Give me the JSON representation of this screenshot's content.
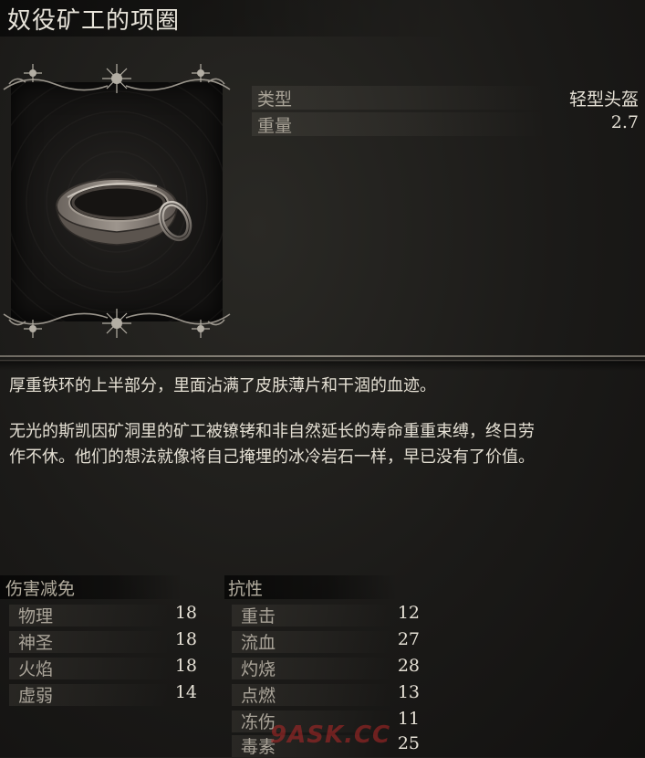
{
  "item": {
    "name": "奴役矿工的项圈",
    "image_icon": "iron-collar-icon"
  },
  "info": [
    {
      "label": "类型",
      "value": "轻型头盔"
    },
    {
      "label": "重量",
      "value": "2.7"
    }
  ],
  "description": {
    "p1": "厚重铁环的上半部分，里面沾满了皮肤薄片和干涸的血迹。",
    "p2_line1": "无光的斯凯因矿洞里的矿工被镣铐和非自然延长的寿命重重束缚，终日劳",
    "p2_line2": "作不休。他们的想法就像将自己掩埋的冰冷岩石一样，早已没有了价值。"
  },
  "damage_reduction": {
    "title": "伤害减免",
    "rows": [
      {
        "label": "物理",
        "value": "18"
      },
      {
        "label": "神圣",
        "value": "18"
      },
      {
        "label": "火焰",
        "value": "18"
      },
      {
        "label": "虚弱",
        "value": "14"
      }
    ]
  },
  "resistance": {
    "title": "抗性",
    "rows": [
      {
        "label": "重击",
        "value": "12"
      },
      {
        "label": "流血",
        "value": "27"
      },
      {
        "label": "灼烧",
        "value": "28"
      },
      {
        "label": "点燃",
        "value": "13"
      },
      {
        "label": "冻伤",
        "value": "11"
      },
      {
        "label": "毒素",
        "value": "25"
      }
    ]
  },
  "watermark": "9ASK.CC",
  "colors": {
    "background": "#1b1a18",
    "text": "#e6e1d6",
    "label": "#aaa499"
  }
}
